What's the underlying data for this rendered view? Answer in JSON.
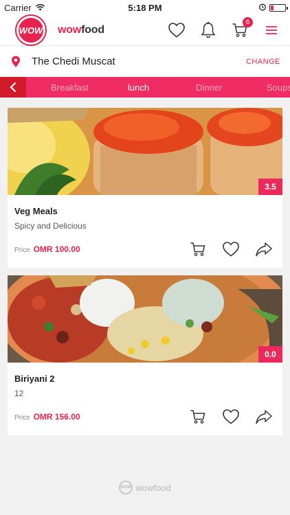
{
  "status_bar": {
    "carrier": "Carrier",
    "time": "5:18 PM"
  },
  "header": {
    "logo_text": "WOW",
    "brand_prefix": "wow",
    "brand_suffix": "food",
    "cart_count": "6",
    "accent_color": "#e8224e"
  },
  "location": {
    "name": "The Chedi Muscat",
    "change_label": "CHANGE"
  },
  "categories": {
    "items": [
      "Breakfast",
      "lunch",
      "Dinner",
      "Soups"
    ],
    "active": "lunch"
  },
  "items": [
    {
      "title": "Veg Meals",
      "subtitle": "Spicy and Delicious",
      "price_label": "Price",
      "price": "OMR 100.00",
      "rating": "3.5"
    },
    {
      "title": "Biriyani 2",
      "subtitle": "12",
      "price_label": "Price",
      "price": "OMR 156.00",
      "rating": "0.0"
    }
  ],
  "footer": {
    "brand": "wowfood"
  },
  "icons": [
    "location-pin-icon",
    "heart-icon",
    "bell-icon",
    "cart-icon",
    "menu-icon",
    "chevron-left-icon",
    "share-icon"
  ]
}
